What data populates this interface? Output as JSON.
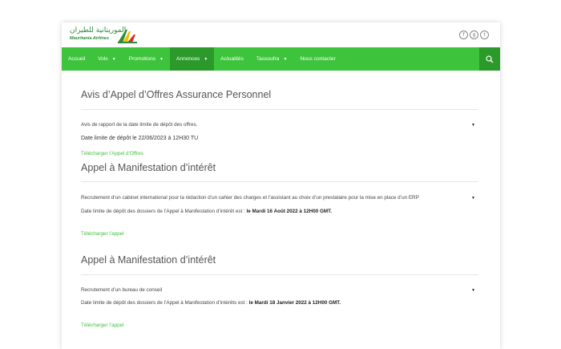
{
  "header": {
    "logo_ar": "الموريتانية للطيران",
    "logo_en": "Mauritania Airlines"
  },
  "social_icons": [
    "facebook-icon",
    "google-plus-icon",
    "twitter-icon"
  ],
  "social_glyphs": [
    "f",
    "g",
    "t"
  ],
  "nav": {
    "items": [
      {
        "label": "Accueil",
        "dropdown": false
      },
      {
        "label": "Vols",
        "dropdown": true
      },
      {
        "label": "Promotions",
        "dropdown": true
      },
      {
        "label": "Annonces",
        "dropdown": true,
        "active": true
      },
      {
        "label": "Actualités",
        "dropdown": false
      },
      {
        "label": "Tassoufra",
        "dropdown": true
      },
      {
        "label": "Nous contacter",
        "dropdown": false
      }
    ],
    "caret": "▼"
  },
  "colors": {
    "brand_green": "#3ec43c",
    "active_green": "#2b9a2a"
  },
  "sections": [
    {
      "title": "Avis d’Appel d’Offres Assurance Personnel",
      "description": "Avis de rapport de la date limite de dépôt des offres.",
      "deadline": "Date limite de dépôt le 22/06/2023 à 12H30 TU",
      "link": "Télécharger l’Appel d’Offres",
      "toggle": "▼"
    },
    {
      "title": "Appel à Manifestation d’intérêt",
      "description": "Recrutement d’un cabinet international pour la rédaction d’un cahier des charges et l’assistant au choix d’un prestataire pour la mise en place d’un ERP",
      "deadline_prefix": "Date limite de dépôt des dossiers de l’Appel à Manifestation d’intérêt est : ",
      "deadline_date": " le Mardi 16 Août 2022 à 12H00 GMT.",
      "link": "Télécharger l’appel",
      "toggle": "▼"
    },
    {
      "title": "Appel à Manifestation d’intérêt",
      "description": "Recrutement d’un bureau de conseil",
      "deadline_prefix": "Date limite de dépôt des dossiers de l’Appel à Manifestation d’intérêts est : ",
      "deadline_date": " le Mardi 18 Janvier 2022 à 12H00 GMT.",
      "link": "Télécharger l’appel",
      "toggle": "▼"
    }
  ]
}
